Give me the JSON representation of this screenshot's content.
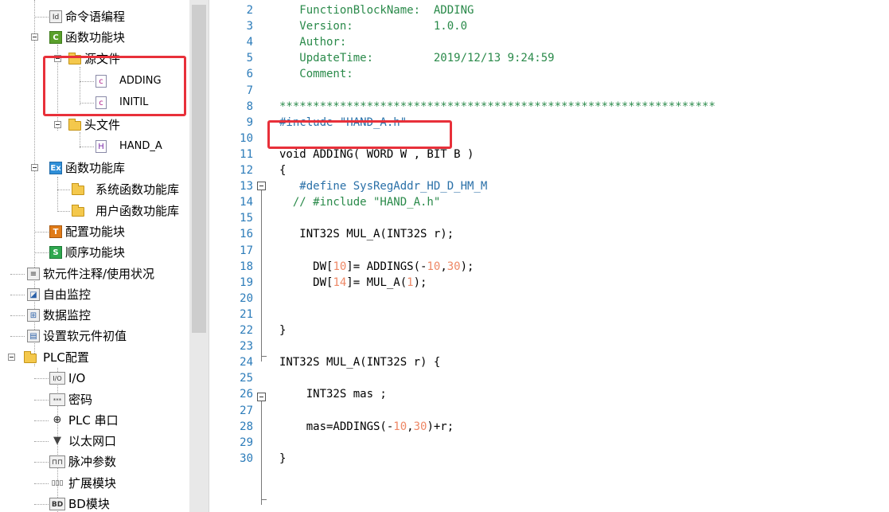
{
  "tree": {
    "items": [
      {
        "label": "命令语编程",
        "icon": "id-icon"
      },
      {
        "label": "函数功能块",
        "icon": "c-block-icon"
      },
      {
        "label": "源文件",
        "icon": "folder-icon"
      },
      {
        "label": "ADDING",
        "icon": "c-file-icon"
      },
      {
        "label": "INITIL",
        "icon": "c-file-icon"
      },
      {
        "label": "头文件",
        "icon": "folder-icon"
      },
      {
        "label": "HAND_A",
        "icon": "h-file-icon"
      },
      {
        "label": "函数功能库",
        "icon": "ex-icon"
      },
      {
        "label": "系统函数功能库",
        "icon": "folder-icon"
      },
      {
        "label": "用户函数功能库",
        "icon": "folder-icon"
      },
      {
        "label": "配置功能块",
        "icon": "t-icon"
      },
      {
        "label": "顺序功能块",
        "icon": "s-icon"
      },
      {
        "label": "软元件注释/使用状况",
        "icon": "list-icon"
      },
      {
        "label": "自由监控",
        "icon": "monitor-icon"
      },
      {
        "label": "数据监控",
        "icon": "data-monitor-icon"
      },
      {
        "label": "设置软元件初值",
        "icon": "init-icon"
      },
      {
        "label": "PLC配置",
        "icon": "folder-icon"
      },
      {
        "label": "I/O",
        "icon": "io-icon"
      },
      {
        "label": "密码",
        "icon": "password-icon"
      },
      {
        "label": "PLC 串口",
        "icon": "serial-port-icon"
      },
      {
        "label": "以太网口",
        "icon": "ethernet-icon"
      },
      {
        "label": "脉冲参数",
        "icon": "pulse-icon"
      },
      {
        "label": "扩展模块",
        "icon": "expansion-icon"
      },
      {
        "label": "BD模块",
        "icon": "bd-icon"
      }
    ]
  },
  "editor": {
    "lines": [
      {
        "n": "2",
        "text": "   FunctionBlockName:  ADDING"
      },
      {
        "n": "3",
        "text": "   Version:            1.0.0"
      },
      {
        "n": "4",
        "text": "   Author:"
      },
      {
        "n": "5",
        "text": "   UpdateTime:         2019/12/13 9:24:59"
      },
      {
        "n": "6",
        "text": "   Comment:"
      },
      {
        "n": "7",
        "text": ""
      },
      {
        "n": "8",
        "text": "*****************************************************************"
      },
      {
        "n": "9",
        "text": "#include \"HAND_A.h\""
      },
      {
        "n": "10",
        "text": ""
      },
      {
        "n": "11",
        "text": "void ADDING( WORD W , BIT B )"
      },
      {
        "n": "12",
        "text": "{"
      },
      {
        "n": "13",
        "text": "   #define SysRegAddr_HD_D_HM_M"
      },
      {
        "n": "14",
        "text": "  // #include \"HAND_A.h\""
      },
      {
        "n": "15",
        "text": ""
      },
      {
        "n": "16",
        "text": "   INT32S MUL_A(INT32S r);"
      },
      {
        "n": "17",
        "text": ""
      },
      {
        "n": "18",
        "text": "     DW[10]= ADDINGS(-10,30);"
      },
      {
        "n": "19",
        "text": "     DW[14]= MUL_A(1);"
      },
      {
        "n": "20",
        "text": ""
      },
      {
        "n": "21",
        "text": ""
      },
      {
        "n": "22",
        "text": "}"
      },
      {
        "n": "23",
        "text": ""
      },
      {
        "n": "24",
        "text": "INT32S MUL_A(INT32S r) {"
      },
      {
        "n": "25",
        "text": ""
      },
      {
        "n": "26",
        "text": "    INT32S mas ;"
      },
      {
        "n": "27",
        "text": ""
      },
      {
        "n": "28",
        "text": "    mas=ADDINGS(-10,30)+r;"
      },
      {
        "n": "29",
        "text": ""
      },
      {
        "n": "30",
        "text": "}"
      }
    ]
  },
  "colors": {
    "line_numbers": "#2b7bb9",
    "comment": "#2a8a4a",
    "preprocessor": "#2a70a8",
    "number": "#ee8866",
    "highlight_box": "#e8303a"
  }
}
